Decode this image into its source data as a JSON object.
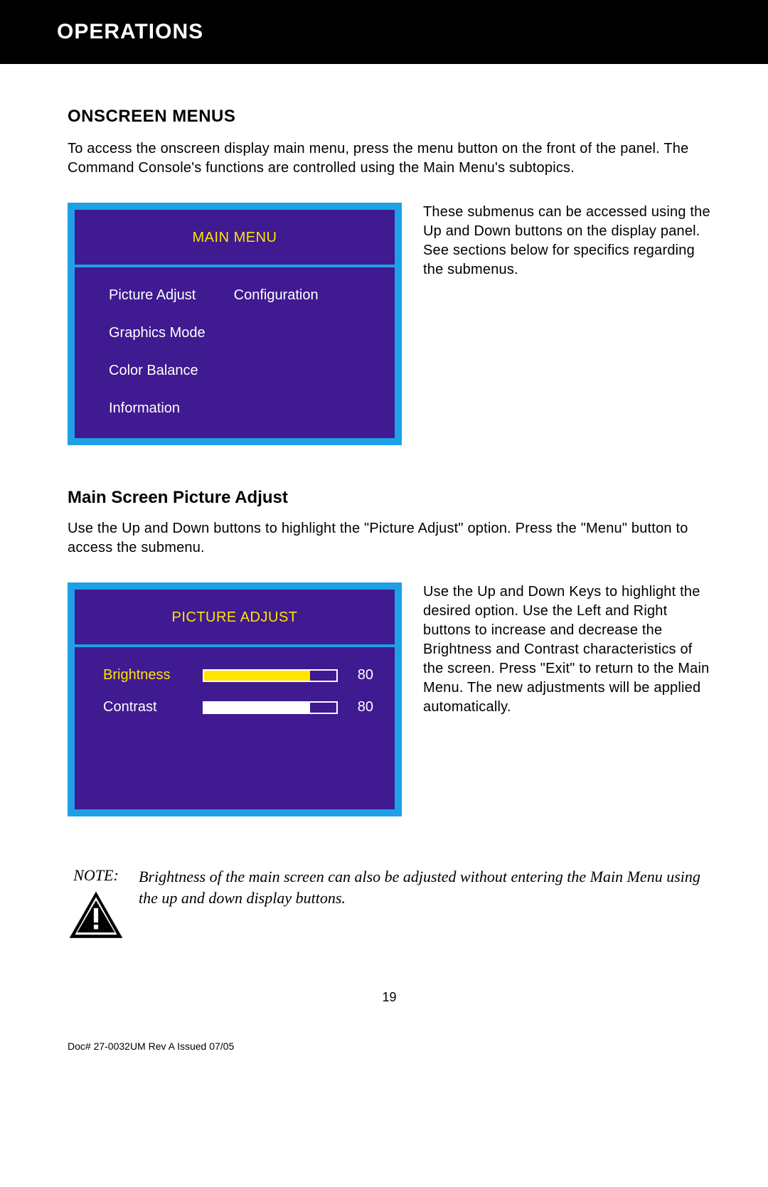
{
  "header": {
    "title": "OPERATIONS"
  },
  "section1": {
    "title": "ONSCREEN MENUS",
    "intro": "To access the onscreen display main menu, press the menu button on the front of the panel. The Command Console's functions are controlled using the Main Menu's subtopics.",
    "side": "These submenus can be accessed using the Up and Down buttons on the display panel. See sections below for specifics regarding the submenus."
  },
  "mainMenu": {
    "title": "MAIN MENU",
    "leftItems": [
      "Picture Adjust",
      "Graphics Mode",
      "Color Balance",
      "Information"
    ],
    "rightItems": [
      "Configuration"
    ]
  },
  "section2": {
    "title": "Main Screen Picture Adjust",
    "intro": "Use the Up and Down buttons to highlight the \"Picture Adjust\" option.  Press the \"Menu\" button to access the submenu.",
    "side": "Use the Up and Down Keys to highlight the desired option. Use the Left and Right buttons to increase and decrease the Brightness and Contrast characteristics of the screen. Press \"Exit\" to return to the Main Menu. The new adjustments will be applied automatically."
  },
  "pictureAdjust": {
    "title": "PICTURE ADJUST",
    "brightness": {
      "label": "Brightness",
      "value": "80"
    },
    "contrast": {
      "label": "Contrast",
      "value": "80"
    }
  },
  "note": {
    "label": "NOTE:",
    "text": "Brightness of the main screen can also be adjusted without entering the Main Menu using the up and down display buttons."
  },
  "footer": {
    "pageNum": "19",
    "docId": "Doc# 27-0032UM Rev A Issued 07/05"
  }
}
